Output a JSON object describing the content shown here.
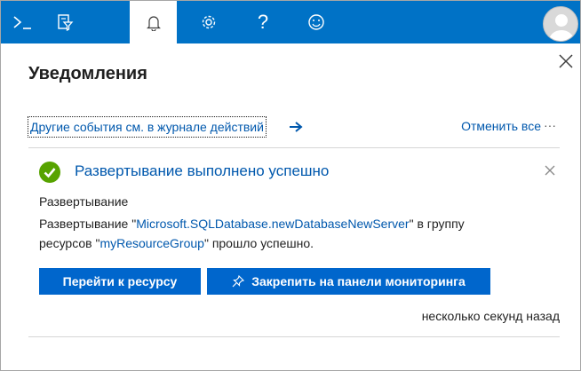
{
  "topbar": {
    "bg_color": "#0072c6",
    "items": [
      {
        "icon": "cloud-shell-icon"
      },
      {
        "icon": "directory-filter-icon"
      },
      {
        "icon": "bell-icon",
        "active": true
      },
      {
        "icon": "gear-icon"
      },
      {
        "icon": "help-icon",
        "glyph": "?"
      },
      {
        "icon": "feedback-smiley-icon"
      }
    ],
    "avatar_icon": "user-avatar-icon"
  },
  "panel": {
    "title": "Уведомления",
    "activity_link": "Другие события см. в журнале действий",
    "dismiss_all": "Отменить все",
    "more": "···"
  },
  "notification": {
    "status_color": "#57a300",
    "title": "Развертывание выполнено успешно",
    "subtitle": "Развертывание",
    "body_prefix": "Развертывание \"",
    "deployment_name": "Microsoft.SQLDatabase.newDatabaseNewServer",
    "body_mid": "\" в группу ресурсов \"",
    "resource_group": "myResourceGroup",
    "body_suffix": "\" прошло успешно.",
    "go_to_resource": "Перейти к ресурсу",
    "pin_to_dashboard": "Закрепить на панели мониторинга",
    "timestamp": "несколько секунд назад"
  }
}
